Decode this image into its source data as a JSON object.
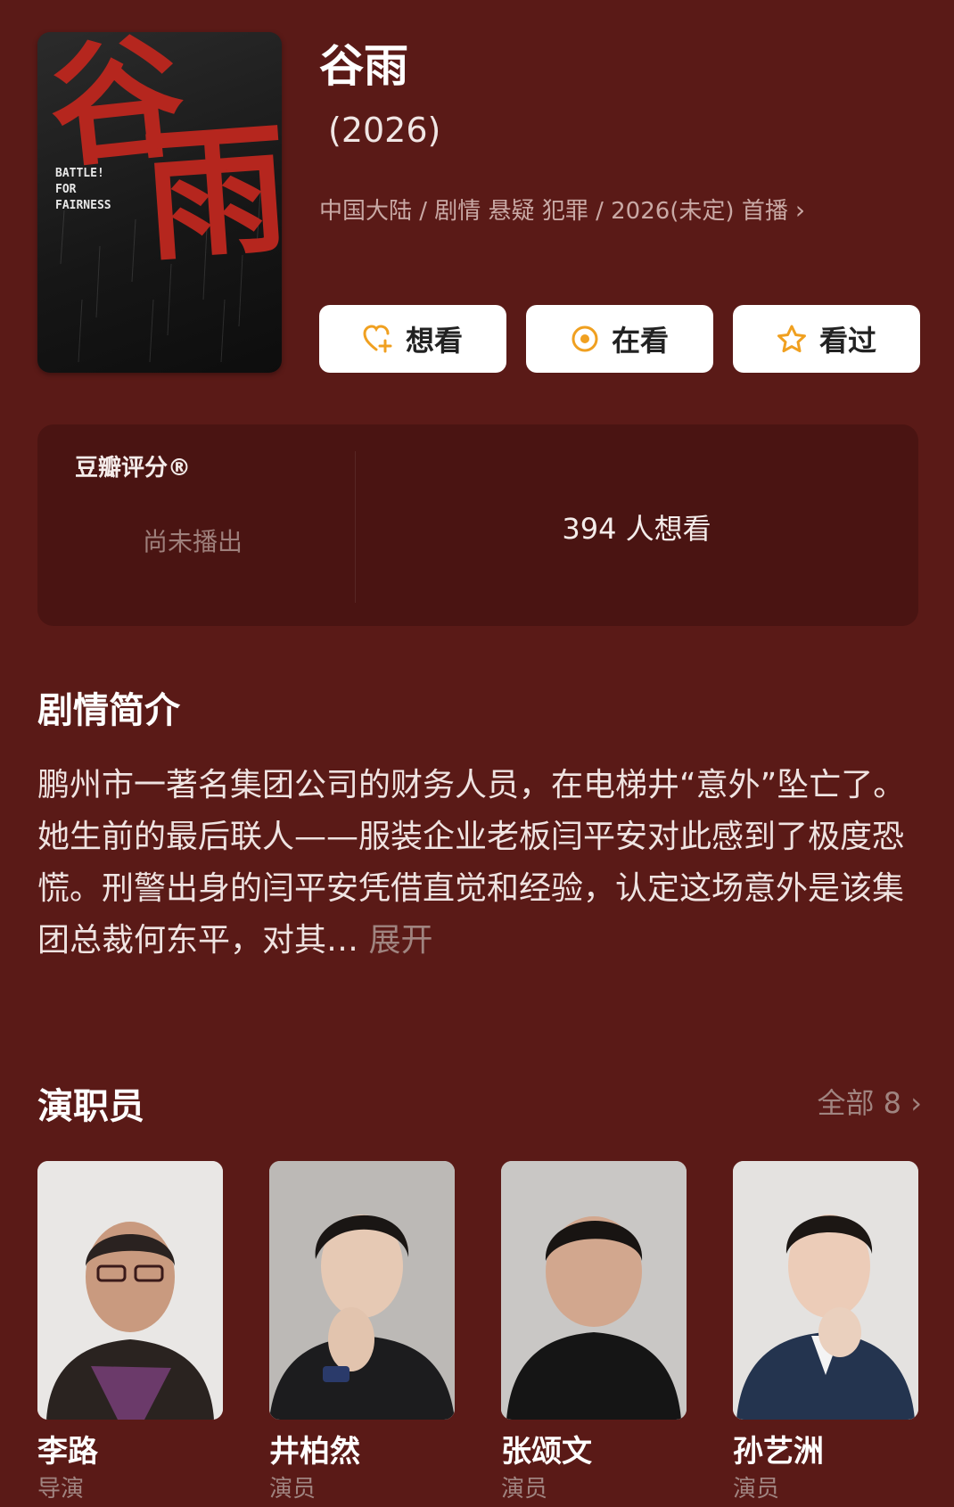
{
  "movie": {
    "title": "谷雨",
    "year": "(2026)",
    "meta": "中国大陆 / 剧情 悬疑 犯罪 / 2026(未定) 首播",
    "poster": {
      "title_chars": [
        "谷",
        "雨"
      ],
      "english_text": "BATTLE!\n FOR\nFAIRNESS"
    }
  },
  "actions": [
    {
      "label": "想看",
      "icon": "heart-plus-icon"
    },
    {
      "label": "在看",
      "icon": "target-icon"
    },
    {
      "label": "看过",
      "icon": "star-icon"
    }
  ],
  "rating": {
    "label": "豆瓣评分®",
    "status": "尚未播出",
    "wish_count": "394 人想看"
  },
  "synopsis": {
    "heading": "剧情简介",
    "text": "鹏州市一著名集团公司的财务人员，在电梯井“意外”坠亡了。她生前的最后联人——服装企业老板闫平安对此感到了极度恐慌。刑警出身的闫平安凭借直觉和经验，认定这场意外是该集团总裁何东平，对其…",
    "expand_label": "展开"
  },
  "cast": {
    "heading": "演职员",
    "all_label": "全部 8",
    "members": [
      {
        "name": "李路",
        "role": "导演"
      },
      {
        "name": "井柏然",
        "role": "演员"
      },
      {
        "name": "张颂文",
        "role": "演员"
      },
      {
        "name": "孙艺洲",
        "role": "演员"
      }
    ]
  },
  "colors": {
    "background": "#5a1a17",
    "panel": "#4a1412",
    "accent": "#f0a020"
  }
}
